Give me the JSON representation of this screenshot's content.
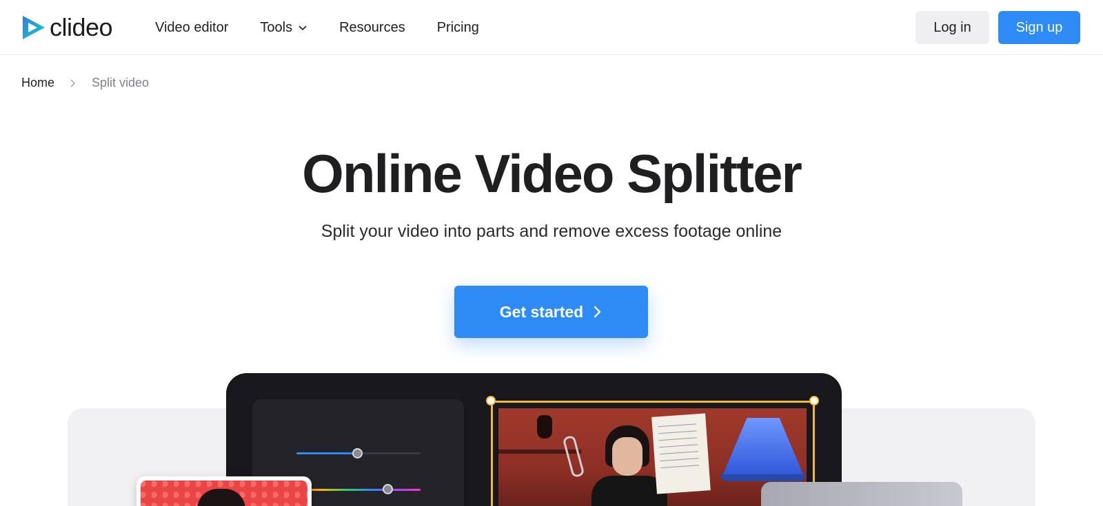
{
  "header": {
    "logo_text": "clideo",
    "nav": [
      {
        "label": "Video editor"
      },
      {
        "label": "Tools",
        "has_dropdown": true
      },
      {
        "label": "Resources"
      },
      {
        "label": "Pricing"
      }
    ],
    "login_label": "Log in",
    "signup_label": "Sign up"
  },
  "breadcrumb": {
    "home": "Home",
    "current": "Split video"
  },
  "hero": {
    "title": "Online Video Splitter",
    "subtitle": "Split your video into parts and remove excess footage online",
    "cta_label": "Get started"
  },
  "colors": {
    "accent": "#2e8bf5",
    "frame_highlight": "#f5b82e",
    "device_bg": "#18181c"
  }
}
